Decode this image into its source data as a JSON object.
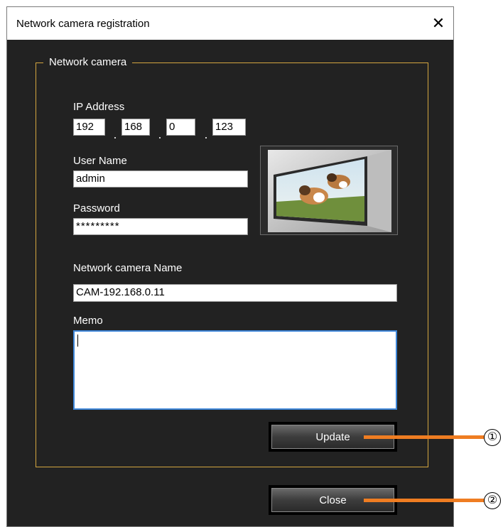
{
  "window": {
    "title": "Network camera registration",
    "close_glyph": "✕"
  },
  "group": {
    "legend": "Network camera"
  },
  "ip": {
    "label": "IP Address",
    "octets": [
      "192",
      "168",
      "0",
      "123"
    ]
  },
  "user": {
    "label": "User Name",
    "value": "admin"
  },
  "password": {
    "label": "Password",
    "value": "*********"
  },
  "camera_name": {
    "label": "Network camera Name",
    "value": "CAM-192.168.0.11"
  },
  "memo": {
    "label": "Memo",
    "value": ""
  },
  "buttons": {
    "update": "Update",
    "close": "Close"
  },
  "callouts": [
    "①",
    "②"
  ],
  "colors": {
    "accent_border": "#d4a640",
    "callout": "#ef7d22",
    "focus": "#3e86d8",
    "dialog_bg": "#222222"
  },
  "icons": {
    "close": "close-icon",
    "preview": "camera-preview-image"
  }
}
